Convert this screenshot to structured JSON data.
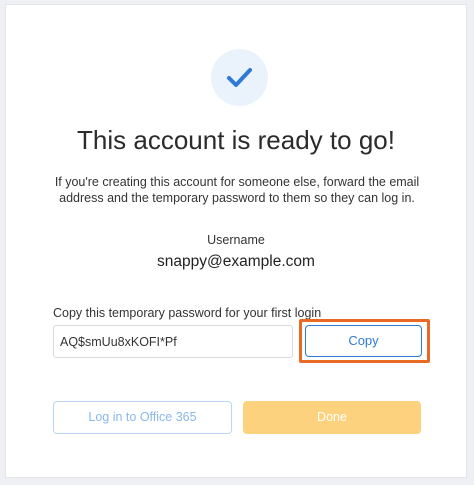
{
  "dialog": {
    "title": "This account is ready to go!",
    "description": "If you're creating this account for someone else, forward the email address and the temporary password to them so they can log in.",
    "username_label": "Username",
    "username_value": "snappy@example.com",
    "password_label": "Copy this temporary password for your first login",
    "password_value": "AQ$smUu8xKOFI*Pf",
    "copy_label": "Copy",
    "login_label": "Log in to Office 365",
    "done_label": "Done",
    "icon": "checkmark-icon"
  },
  "colors": {
    "accent": "#2f7ad6",
    "highlight": "#ea6a25",
    "done_button": "#fdd27e",
    "check_bg": "#eaf2fb"
  }
}
